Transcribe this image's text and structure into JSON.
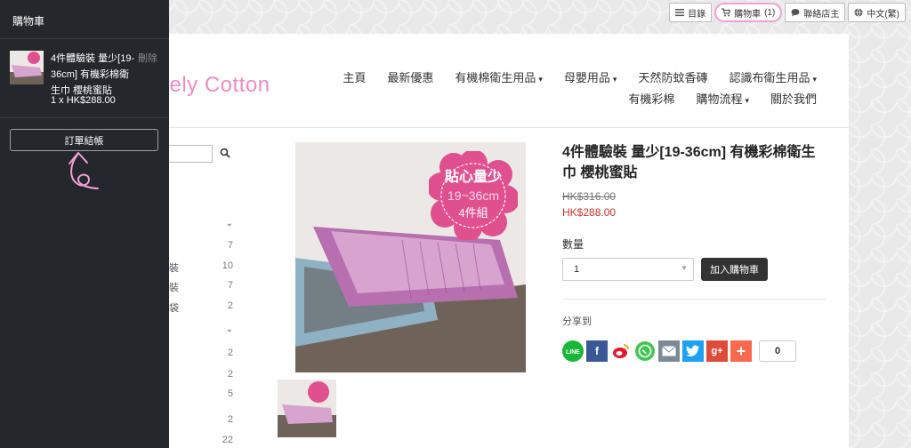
{
  "topbar": {
    "catalog": "目錄",
    "cart": "購物車",
    "cart_count": "(1)",
    "contact": "聯絡店主",
    "language": "中文(繁)"
  },
  "logo": "vely Cotton",
  "nav": {
    "row1": [
      "主頁",
      "最新優惠",
      "有機棉衛生用品",
      "母嬰用品",
      "天然防蚊香磚",
      "認識布衛生用品"
    ],
    "row2": [
      "有機彩棉",
      "購物流程",
      "關於我們"
    ]
  },
  "sidebar": {
    "rows": [
      {
        "label": "",
        "count": "7"
      },
      {
        "label": "裝",
        "count": "10"
      },
      {
        "label": "裝",
        "count": "7"
      },
      {
        "label": "袋",
        "count": "2"
      },
      {
        "label": "",
        "count": "2"
      },
      {
        "label": "",
        "count": "2"
      },
      {
        "label": "",
        "count": "5"
      },
      {
        "label": "",
        "count": "2"
      },
      {
        "label": "",
        "count": "22"
      }
    ]
  },
  "product": {
    "image_badge_line1": "貼心量少",
    "image_badge_line2": "19~36cm",
    "image_badge_line3": "4件組",
    "title": "4件體驗裝 量少[19-36cm] 有機彩棉衛生巾 櫻桃蜜貼",
    "old_price": "HK$316.00",
    "price": "HK$288.00",
    "qty_label": "數量",
    "qty_value": "1",
    "add_to_cart": "加入購物車",
    "share_label": "分享到",
    "share_count": "0"
  },
  "drawer": {
    "title": "購物車",
    "item_name": "4件體驗裝 量少[19-36cm] 有機彩棉衛生巾 櫻桃蜜貼",
    "delete": "刪除",
    "item_price": "1 x  HK$288.00",
    "checkout": "訂單結帳"
  },
  "colors": {
    "drawer_bg": "#24272b",
    "logo_pink": "#ec8cc5",
    "price_red": "#c9302c",
    "annotation_pink": "#f3a0d6"
  }
}
